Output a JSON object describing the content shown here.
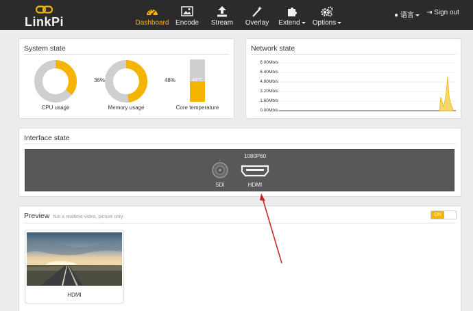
{
  "brand": {
    "name": "LinkPi"
  },
  "nav": {
    "items": [
      {
        "label": "Dashboard",
        "icon": "dashboard-icon"
      },
      {
        "label": "Encode",
        "icon": "image-icon"
      },
      {
        "label": "Stream",
        "icon": "upload-icon"
      },
      {
        "label": "Overlay",
        "icon": "magic-wand-icon"
      },
      {
        "label": "Extend",
        "icon": "puzzle-icon"
      },
      {
        "label": "Options",
        "icon": "gears-icon"
      }
    ],
    "language": "语言",
    "signout": "Sign out"
  },
  "system_state": {
    "title": "System state",
    "cpu": {
      "value": 36,
      "text": "36%",
      "label": "CPU usage"
    },
    "memory": {
      "value": 48,
      "text": "48%",
      "label": "Memory usage"
    },
    "temperature": {
      "value": 48,
      "text": "48℃",
      "label": "Core temperature"
    }
  },
  "network_state": {
    "title": "Network state",
    "y_labels": [
      "8.00Mb/s",
      "6.40Mb/s",
      "4.80Mb/s",
      "3.20Mb/s",
      "1.60Mb/s",
      "0.00Mb/s"
    ]
  },
  "interface_state": {
    "title": "Interface state",
    "sdi": {
      "label": "SDI"
    },
    "hdmi": {
      "label": "HDMI",
      "resolution": "1080P60"
    }
  },
  "preview": {
    "title": "Preview",
    "subtitle": "Not a realtime video, picture only.",
    "toggle": "ON",
    "thumb_label": "HDMI"
  },
  "colors": {
    "accent": "#f5b400",
    "navbar": "#2b2b2b",
    "annotation": "#c62828"
  }
}
